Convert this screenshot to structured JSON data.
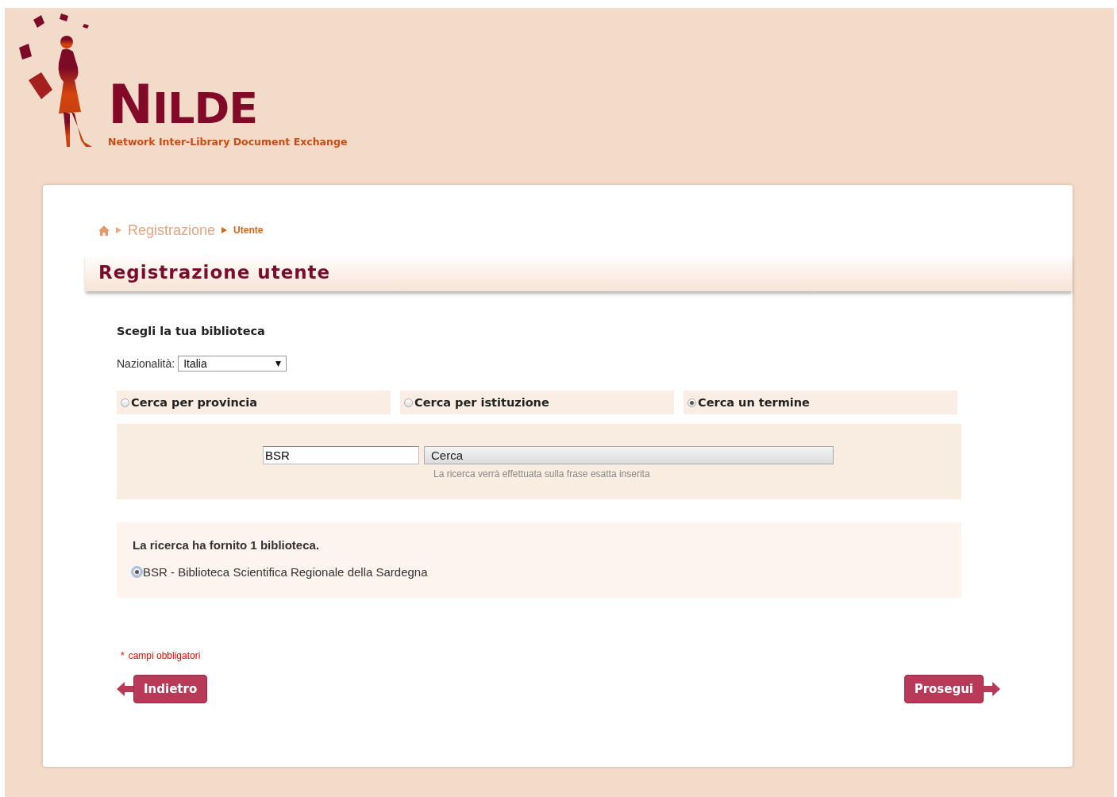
{
  "logo": {
    "title": "NILDE",
    "subtitle": "Network Inter-Library Document Exchange"
  },
  "breadcrumb": [
    {
      "label": "Registrazione",
      "current": false
    },
    {
      "label": "Utente",
      "current": true
    }
  ],
  "page_title": "Registrazione utente",
  "section_title": "Scegli la tua biblioteca",
  "nationality": {
    "label": "Nazionalità:",
    "value": "Italia"
  },
  "search_modes": [
    {
      "label": "Cerca per provincia",
      "selected": false
    },
    {
      "label": "Cerca per istituzione",
      "selected": false
    },
    {
      "label": "Cerca un termine",
      "selected": true
    }
  ],
  "search": {
    "value": "BSR",
    "button": "Cerca",
    "hint": "La ricerca verrà effettuata sulla frase esatta inserita"
  },
  "results": {
    "summary": "La ricerca ha fornito 1 biblioteca.",
    "items": [
      {
        "label": "BSR - Biblioteca Scientifica Regionale della Sardegna",
        "selected": true
      }
    ]
  },
  "required_note": {
    "mark": "*",
    "text": "campi obbligatori"
  },
  "buttons": [
    {
      "label": "Indietro",
      "kind": "back"
    },
    {
      "label": "Prosegui",
      "kind": "next"
    }
  ]
}
